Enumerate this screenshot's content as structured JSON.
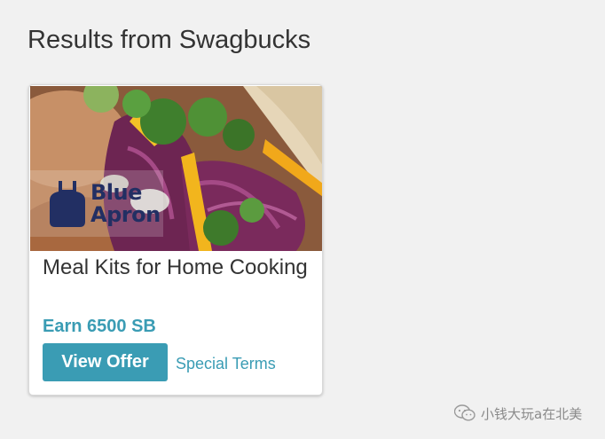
{
  "page": {
    "title": "Results from Swagbucks"
  },
  "offer": {
    "brand": {
      "line1": "Blue",
      "line2": "Apron"
    },
    "name": "Meal Kits for Home Cooking",
    "earn_text": "Earn 6500 SB",
    "button_label": "View Offer",
    "terms_label": "Special Terms",
    "image_alt": "Blue Apron meal photo"
  },
  "watermark": {
    "text": "小钱大玩a在北美"
  },
  "colors": {
    "accent": "#3a9cb4",
    "background": "#f1f1f1",
    "card": "#ffffff",
    "brand_navy": "#222f63"
  }
}
